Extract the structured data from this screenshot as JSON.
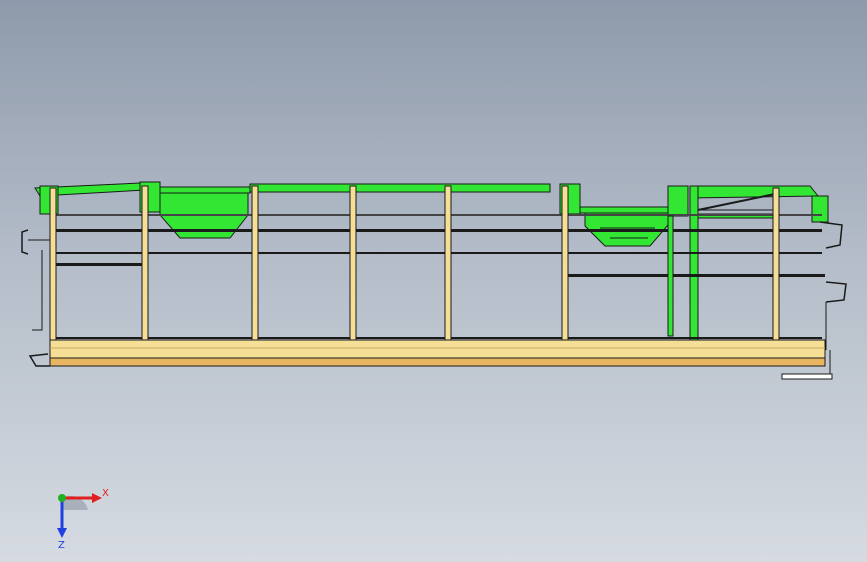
{
  "app": {
    "view": "cad-side-elevation"
  },
  "colors": {
    "background_top": "#8e9aab",
    "background_bottom": "#d6dbe2",
    "frame_green": "#33e633",
    "frame_yellow": "#f5df96",
    "floor_orange": "#e8b560",
    "edge_dark": "#1a1a1a",
    "axis_x": "#e02020",
    "axis_y": "#20b020",
    "axis_z": "#2040e0"
  },
  "triad": {
    "x_label": "X",
    "z_label": "Z",
    "icon": "coordinate-axes-triad-icon"
  }
}
